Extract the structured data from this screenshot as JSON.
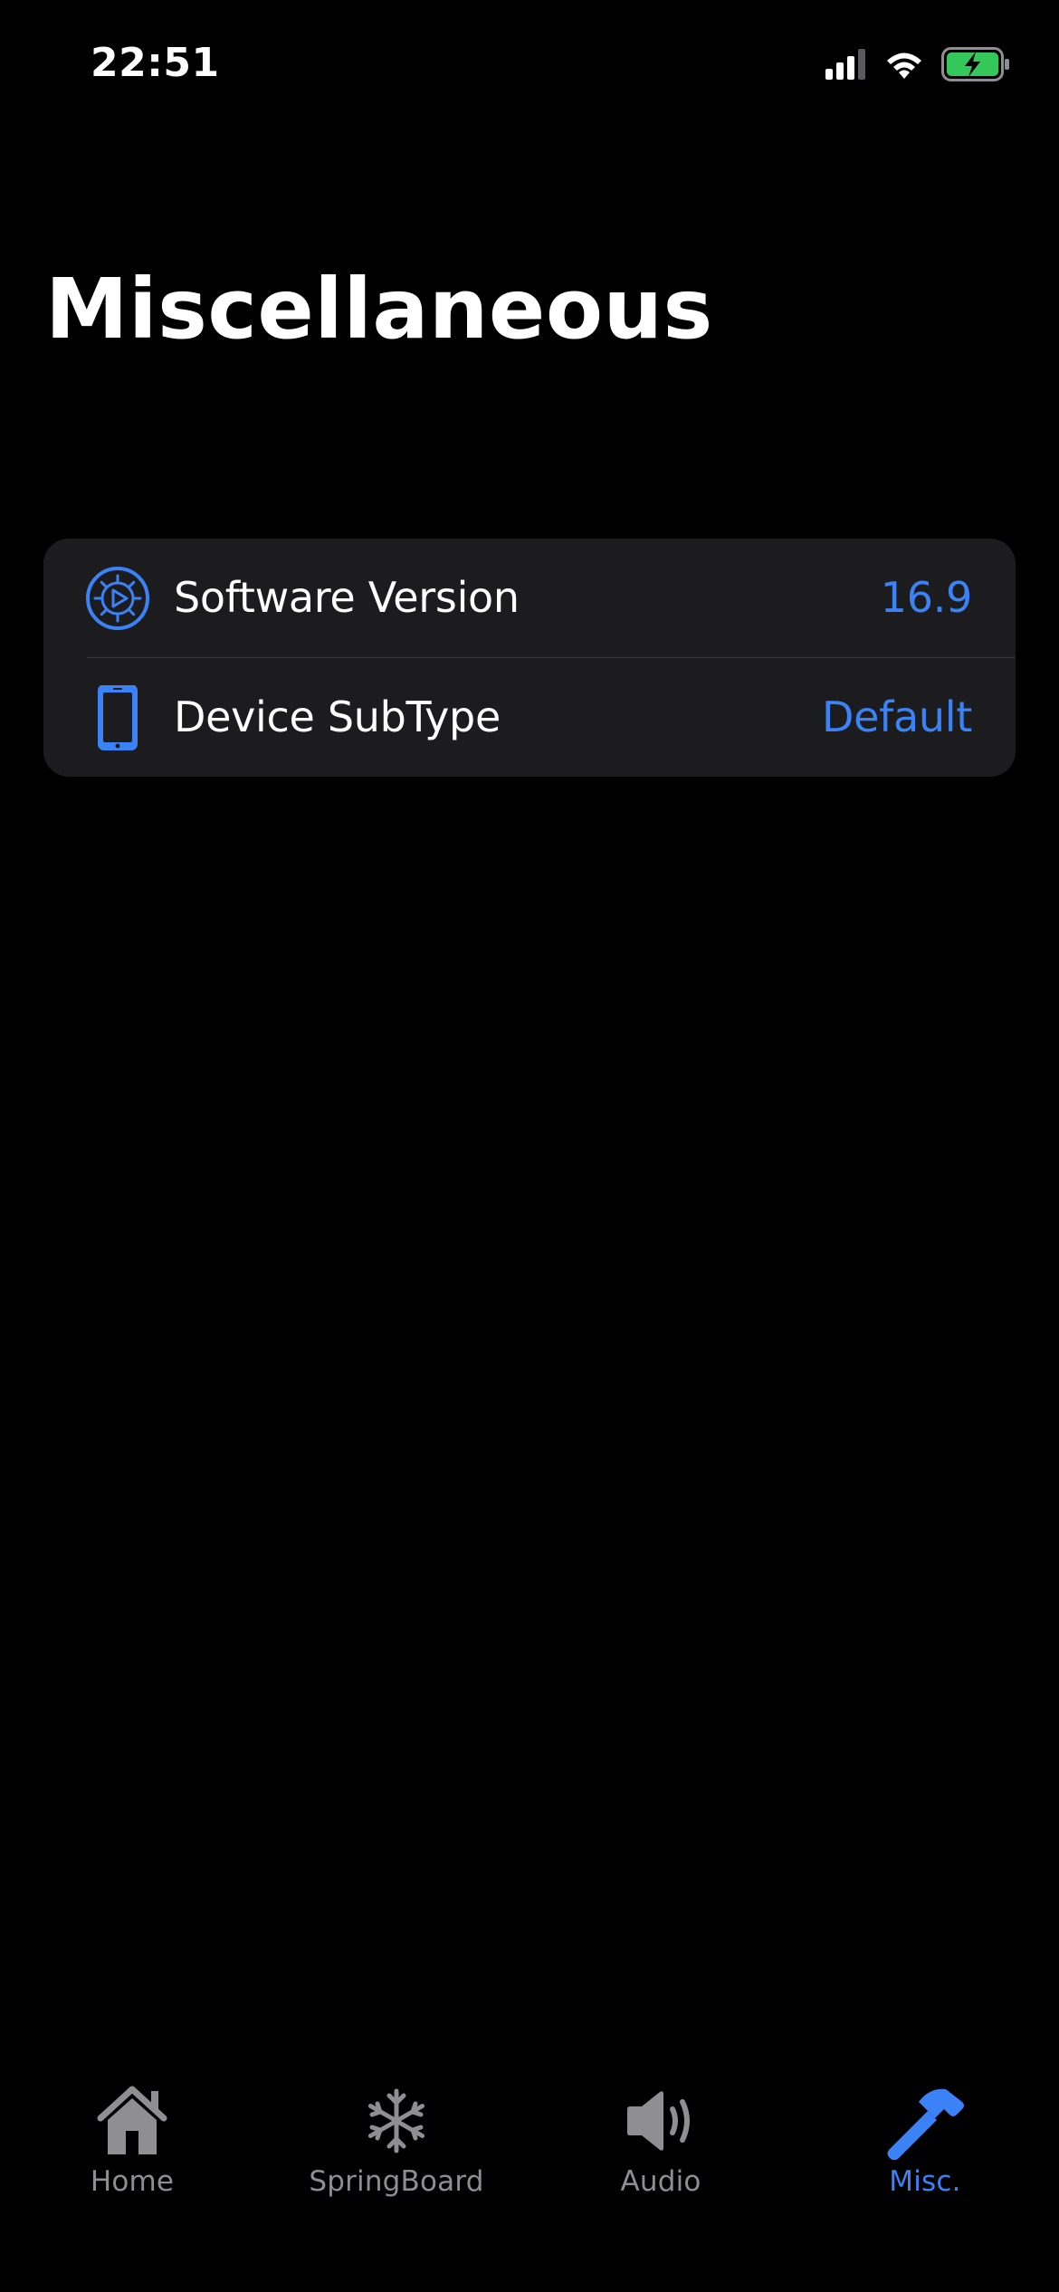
{
  "status_bar": {
    "time": "22:51",
    "battery_color": "#34c759"
  },
  "title": "Miscellaneous",
  "settings": [
    {
      "icon": "gear-icon",
      "label": "Software Version",
      "value": "16.9"
    },
    {
      "icon": "iphone-icon",
      "label": "Device SubType",
      "value": "Default"
    }
  ],
  "tabs": [
    {
      "icon": "house-icon",
      "label": "Home",
      "active": false
    },
    {
      "icon": "snowflake-icon",
      "label": "SpringBoard",
      "active": false
    },
    {
      "icon": "speaker-icon",
      "label": "Audio",
      "active": false
    },
    {
      "icon": "hammer-icon",
      "label": "Misc.",
      "active": true
    }
  ],
  "colors": {
    "accent": "#3b82f6",
    "background": "#000000",
    "group_background": "#1c1c1e",
    "inactive_tab": "#8e8e93"
  }
}
